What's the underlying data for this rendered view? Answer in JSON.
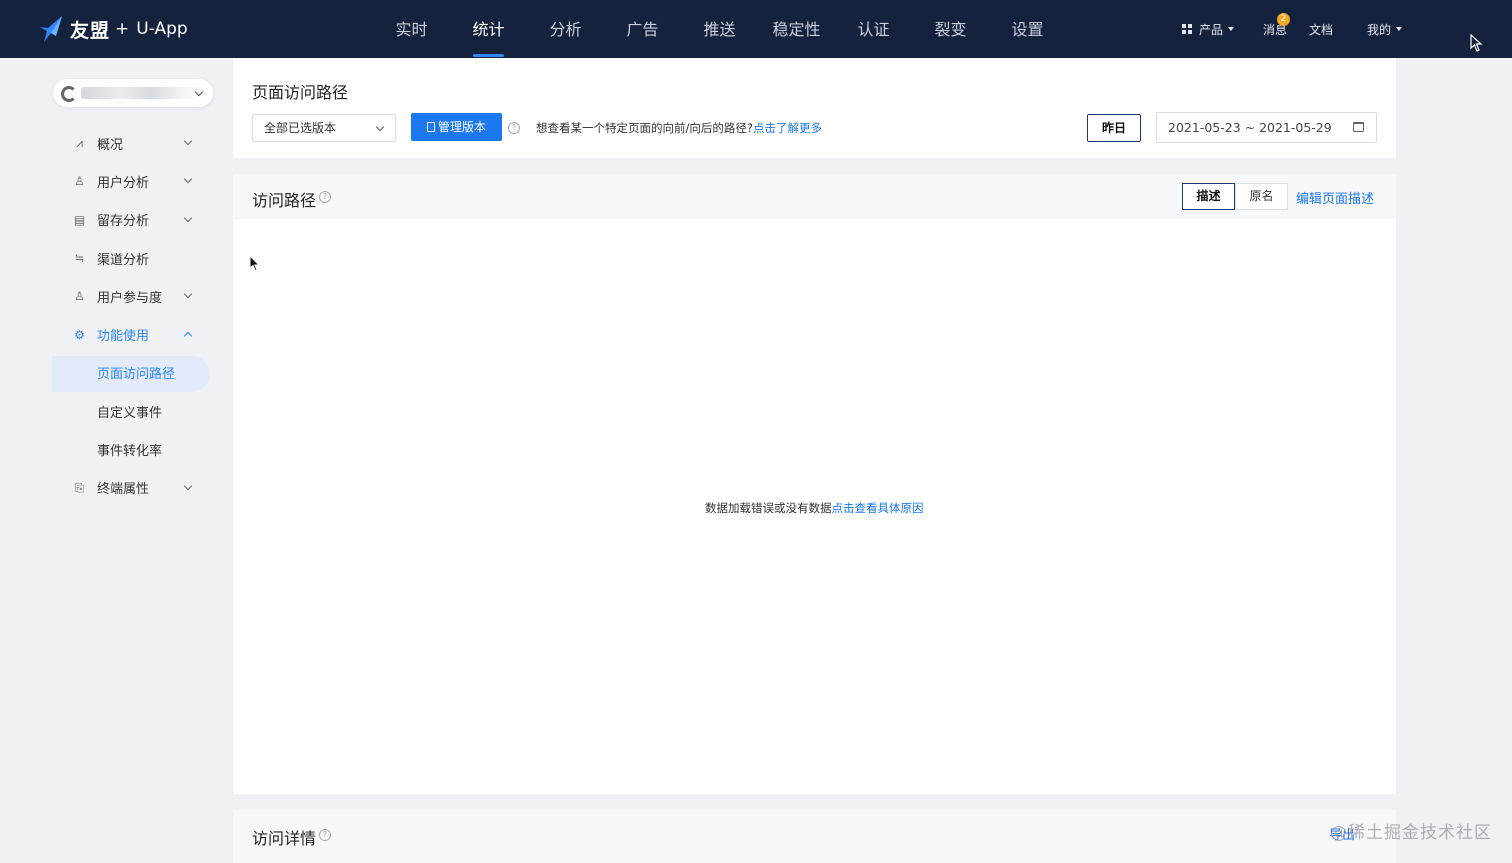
{
  "header": {
    "brand": "友盟",
    "plus": "+",
    "product": "U-App",
    "nav": [
      {
        "label": "实时",
        "active": false
      },
      {
        "label": "统计",
        "active": true
      },
      {
        "label": "分析",
        "active": false
      },
      {
        "label": "广告",
        "active": false
      },
      {
        "label": "推送",
        "active": false
      },
      {
        "label": "稳定性",
        "active": false
      },
      {
        "label": "认证",
        "active": false
      },
      {
        "label": "裂变",
        "active": false
      },
      {
        "label": "设置",
        "active": false
      }
    ],
    "products_label": "产品",
    "messages_label": "消息",
    "messages_count": "2",
    "docs_label": "文档",
    "me_label": "我的"
  },
  "sidebar": {
    "items": [
      {
        "label": "概况",
        "icon": "chart-line-icon"
      },
      {
        "label": "用户分析",
        "icon": "user-analysis-icon"
      },
      {
        "label": "留存分析",
        "icon": "table-icon"
      },
      {
        "label": "渠道分析",
        "icon": "channel-icon"
      },
      {
        "label": "用户参与度",
        "icon": "engagement-icon"
      },
      {
        "label": "功能使用",
        "icon": "gear-icon"
      },
      {
        "label": "页面访问路径"
      },
      {
        "label": "自定义事件"
      },
      {
        "label": "事件转化率"
      },
      {
        "label": "终端属性",
        "icon": "device-icon"
      }
    ]
  },
  "page": {
    "title": "页面访问路径",
    "version_select": "全部已选版本",
    "manage_button": "管理版本",
    "hint_text": "想查看某一个特定页面的向前/向后的路径?",
    "hint_link": "点击了解更多",
    "yesterday_button": "昨日",
    "date_range": "2021-05-23 ~ 2021-05-29"
  },
  "path_panel": {
    "title": "访问路径",
    "toggle_desc": "描述",
    "toggle_raw": "原名",
    "edit_link": "编辑页面描述",
    "empty_text": "数据加载错误或没有数据",
    "empty_link": "点击查看具体原因"
  },
  "detail_panel": {
    "title": "访问详情",
    "export_label": "导出"
  },
  "watermark": "@稀土掘金技术社区",
  "colors": {
    "topbar": "#15223e",
    "accent": "#1c78f0",
    "active_nav_underline": "#2f86ff"
  }
}
